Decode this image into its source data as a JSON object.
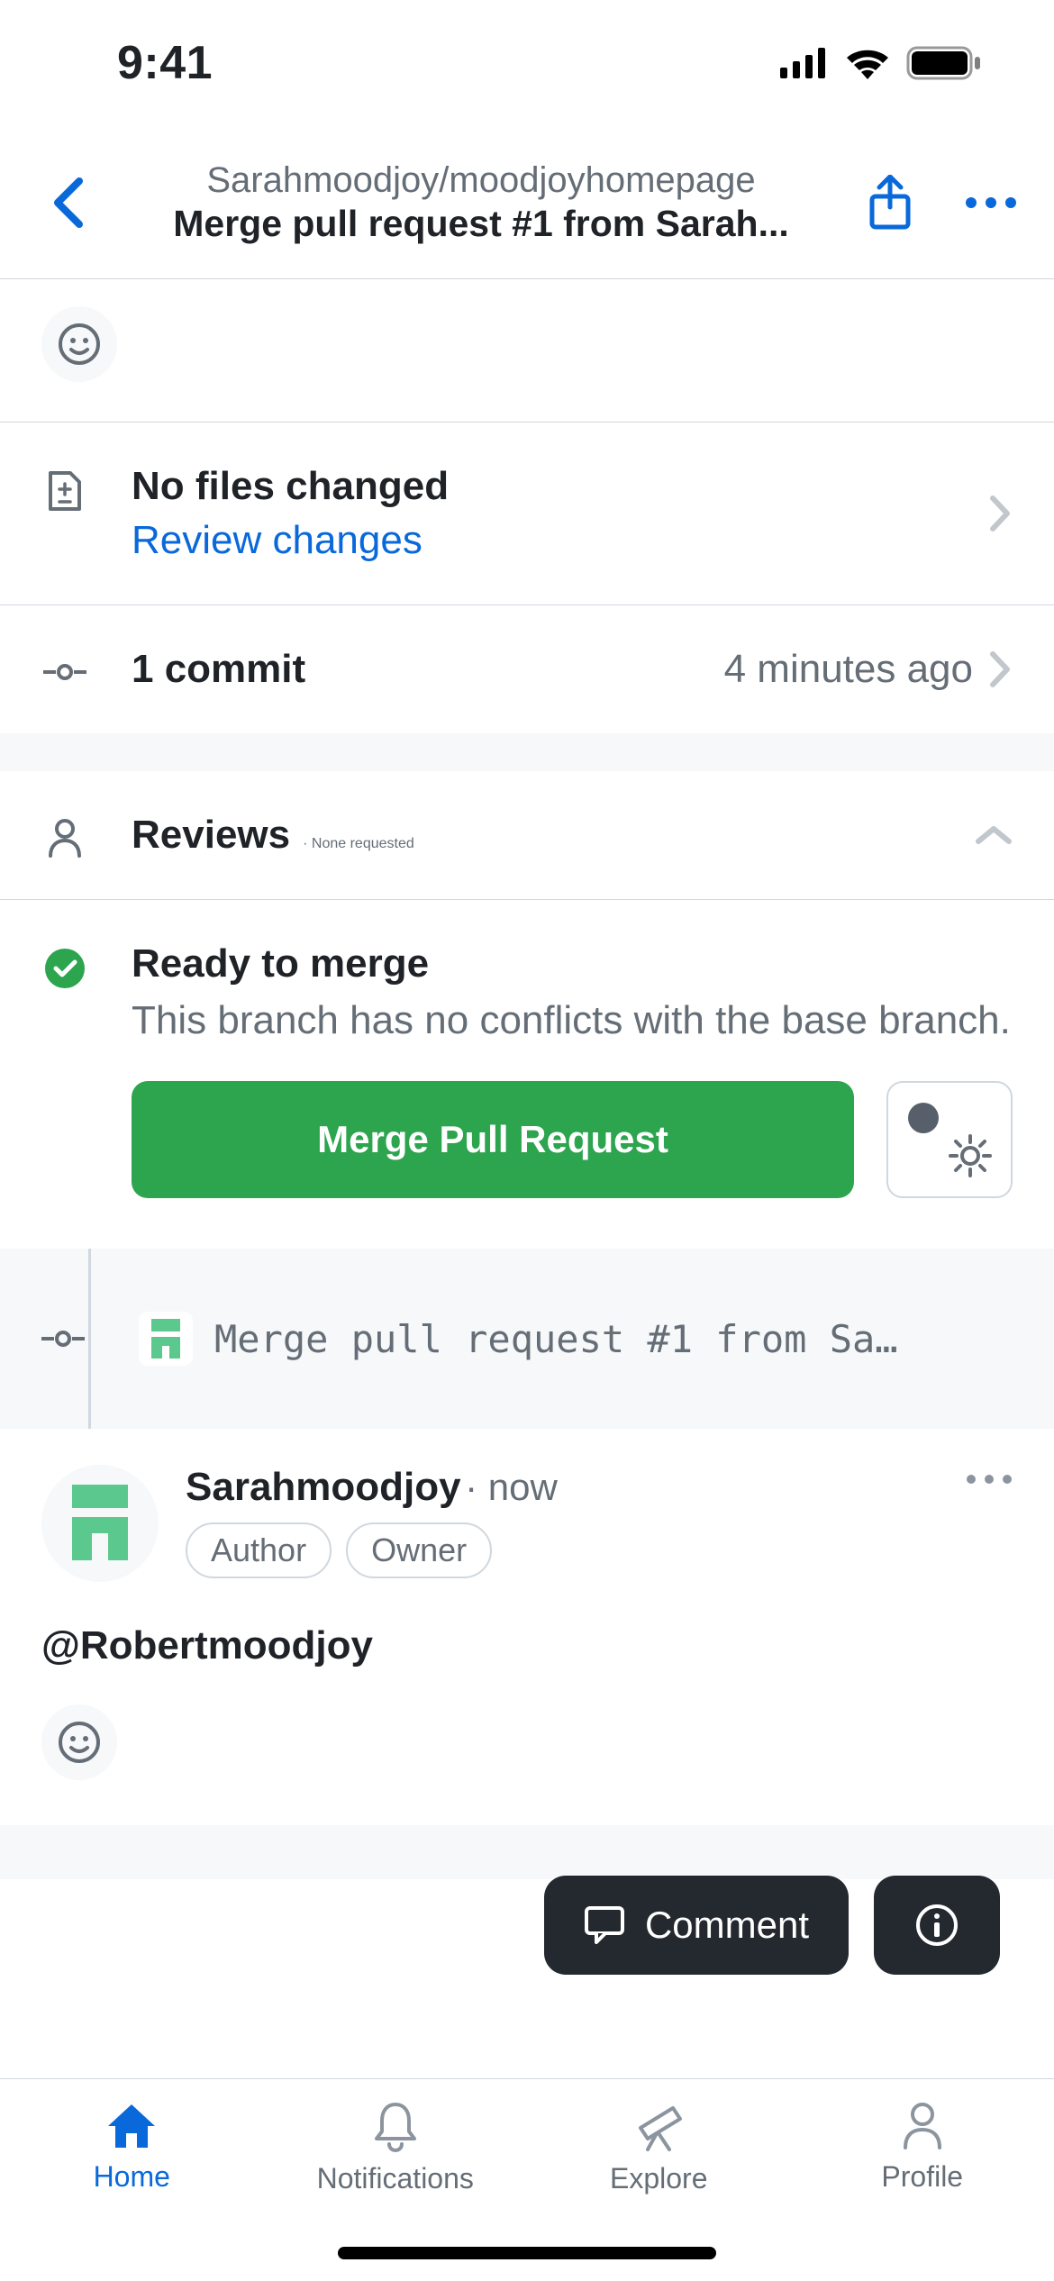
{
  "status_bar": {
    "time": "9:41"
  },
  "nav": {
    "repo": "Sarahmoodjoy/moodjoyhomepage",
    "title": "Merge pull request #1 from Sarah..."
  },
  "files": {
    "title": "No files changed",
    "review_link": "Review changes"
  },
  "commits": {
    "count_label": "1 commit",
    "time_ago": "4 minutes ago"
  },
  "reviews": {
    "label": "Reviews",
    "status": "None requested"
  },
  "merge": {
    "title": "Ready to merge",
    "subtitle": "This branch has no conflicts with the base branch.",
    "button": "Merge Pull Request"
  },
  "commit_strip": {
    "message": "Merge pull request #1 from Sa…"
  },
  "comment": {
    "author": "Sarahmoodjoy",
    "time": "now",
    "badges": [
      "Author",
      "Owner"
    ],
    "body": "@Robertmoodjoy"
  },
  "floating": {
    "comment_label": "Comment"
  },
  "tabs": {
    "home": "Home",
    "notifications": "Notifications",
    "explore": "Explore",
    "profile": "Profile"
  },
  "colors": {
    "accent": "#0969da",
    "success": "#2da44e"
  }
}
